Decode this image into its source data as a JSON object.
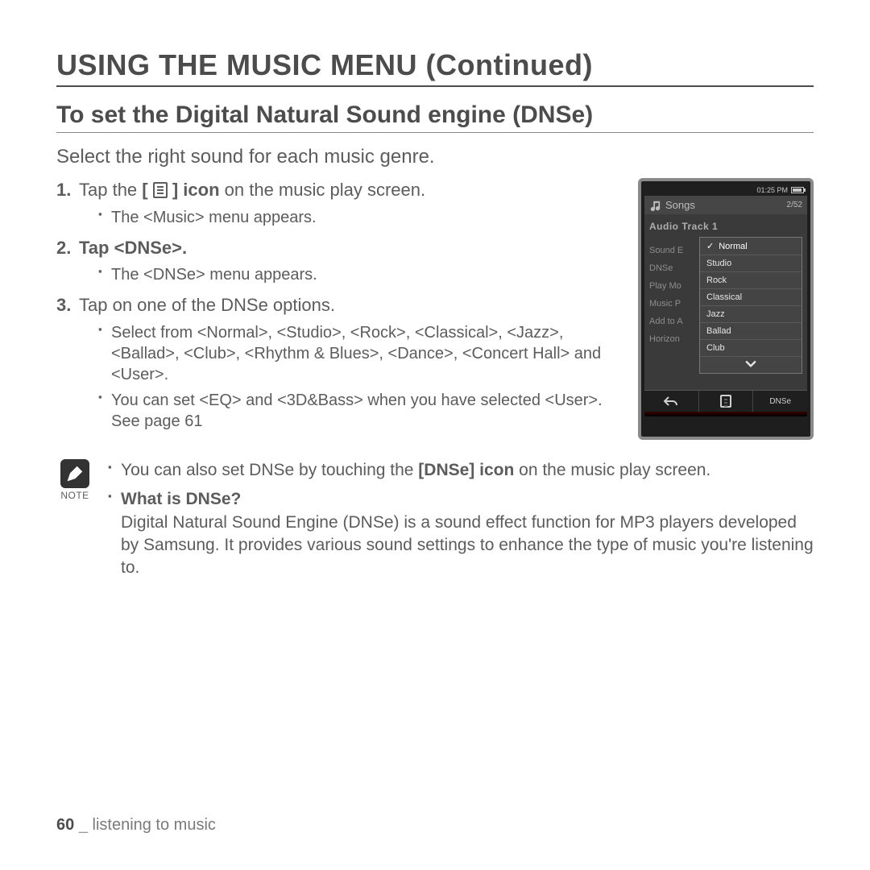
{
  "title": "USING THE MUSIC MENU (Continued)",
  "section": "To set the Digital Natural Sound engine (DNSe)",
  "intro": "Select the right sound for each music genre.",
  "steps": {
    "s1_a": "Tap the ",
    "s1_b": " icon",
    "s1_c": " on the music play screen.",
    "s1_sub1": "The <Music> menu appears.",
    "s2": "Tap <DNSe>.",
    "s2_sub1": "The <DNSe> menu appears.",
    "s3": "Tap on one of the DNSe options.",
    "s3_sub1": "Select from <Normal>, <Studio>, <Rock>, <Classical>, <Jazz>, <Ballad>, <Club>, <Rhythm & Blues>, <Dance>, <Concert Hall> and <User>.",
    "s3_sub2": "You can set <EQ> and <3D&Bass> when you have selected <User>. See page 61"
  },
  "note": {
    "label": "NOTE",
    "line1a": "You can also set DNSe by touching the ",
    "line1b": "[DNSe] icon",
    "line1c": " on the music play screen.",
    "line2q": "What is DNSe?",
    "line2body": "Digital Natural Sound Engine (DNSe) is a sound effect function for MP3 players developed by Samsung. It provides various sound settings to enhance the type of music you're listening to."
  },
  "footer": {
    "page": "60",
    "sep": "_",
    "chapter": "listening to music"
  },
  "device": {
    "time": "01:25 PM",
    "header": "Songs",
    "counter": "2/52",
    "track": "Audio Track 1",
    "bg_menu": [
      "Sound E",
      "DNSe",
      "Play Mo",
      "Music P",
      "Add to A",
      "Horizon"
    ],
    "popup": [
      "Normal",
      "Studio",
      "Rock",
      "Classical",
      "Jazz",
      "Ballad",
      "Club"
    ],
    "popup_selected_index": 0,
    "softkeys": {
      "left": "↶",
      "mid_icon": "menu",
      "right": "DNSe"
    }
  },
  "bracket_open": "[ ",
  "bracket_close": " ]"
}
